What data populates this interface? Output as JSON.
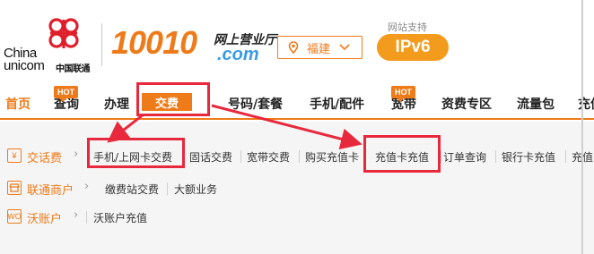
{
  "header": {
    "logo_china": "China",
    "logo_unicom": "unicom",
    "logo_cn": "中国联通",
    "brand_number": "10010",
    "brand_title": "网上营业厅",
    "brand_com": ".com",
    "region": "福建",
    "ipv6_label": "网站支持",
    "ipv6_badge": "IPv6"
  },
  "nav": {
    "items": [
      {
        "label": "首页"
      },
      {
        "label": "查询",
        "badge": "HOT"
      },
      {
        "label": "办理"
      },
      {
        "label": "交费"
      },
      {
        "label": "号码/套餐"
      },
      {
        "label": "手机/配件"
      },
      {
        "label": "宽带",
        "badge": "HOT"
      },
      {
        "label": "资费专区"
      },
      {
        "label": "流量包"
      },
      {
        "label": "充值"
      }
    ]
  },
  "submenu": {
    "rows": [
      {
        "category": "交话费",
        "icon": "yen-icon",
        "links": [
          "手机/上网卡交费",
          "固话交费",
          "宽带交费",
          "购买充值卡",
          "充值卡充值",
          "订单查询",
          "银行卡充值",
          "充值"
        ]
      },
      {
        "category": "联通商户",
        "icon": "shop-icon",
        "links": [
          "缴费站交费",
          "大额业务"
        ]
      },
      {
        "category": "沃账户",
        "icon": "wo-icon",
        "icon_text": "WO",
        "links": [
          "沃账户充值"
        ]
      }
    ]
  },
  "colors": {
    "brand_orange": "#ee7b1a",
    "highlight_red": "#e8283c",
    "com_blue": "#3a9be3"
  }
}
